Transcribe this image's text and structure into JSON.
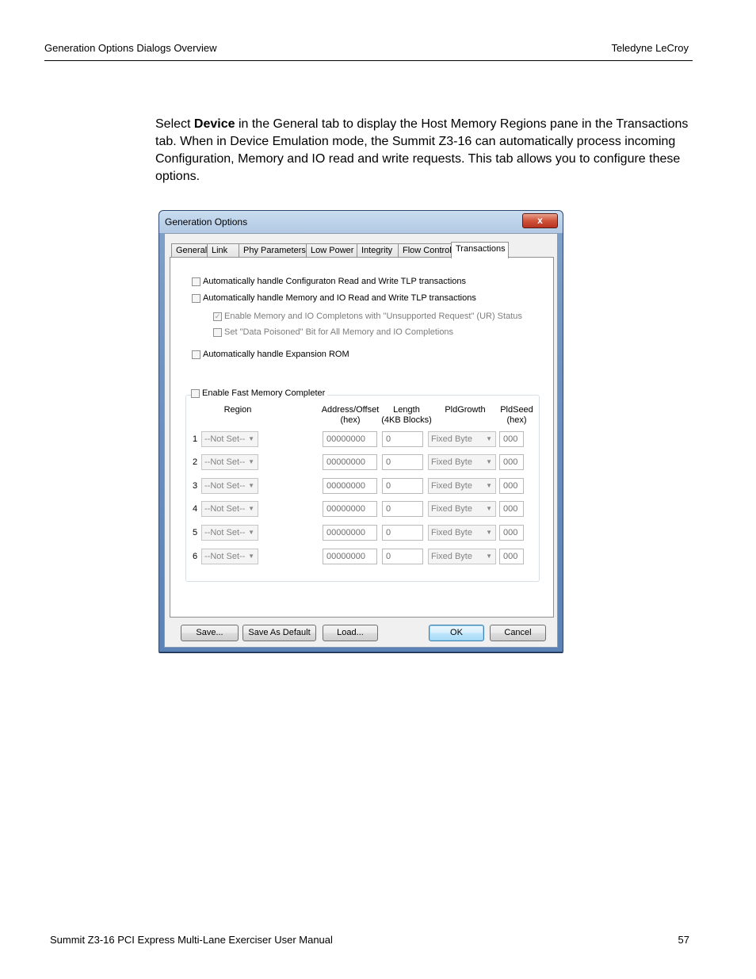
{
  "header": {
    "left": "Generation Options Dialogs Overview",
    "right": "Teledyne  LeCroy"
  },
  "intro": {
    "pre": "Select ",
    "bold": "Device",
    "post": " in the General tab to display the Host Memory Regions pane in the Transactions tab. When in Device Emulation mode, the Summit Z3-16 can automatically process incoming Configuration, Memory and IO read and write requests. This tab allows you to configure these options."
  },
  "dialog": {
    "title": "Generation Options",
    "close": "x",
    "tabs": [
      "General",
      "Link",
      "Phy Parameters",
      "Low Power",
      "Integrity",
      "Flow Control",
      "Transactions"
    ],
    "options": {
      "config": "Automatically handle Configuraton Read and Write TLP transactions",
      "memio": "Automatically handle Memory and IO Read and Write TLP transactions",
      "ur": "Enable Memory and IO Completons with \"Unsupported Request\" (UR) Status",
      "poisoned": "Set \"Data Poisoned\" Bit for All Memory and IO Completions",
      "rom": "Automatically handle Expansion ROM",
      "fast": "Enable Fast Memory Completer"
    },
    "columns": {
      "region": "Region",
      "address1": "Address/Offset",
      "address2": "(hex)",
      "length1": "Length",
      "length2": "(4KB Blocks)",
      "growth": "PldGrowth",
      "seed1": "PldSeed",
      "seed2": "(hex)"
    },
    "rows": [
      {
        "num": "1",
        "region": "--Not Set--",
        "address": "00000000",
        "length": "0",
        "growth": "Fixed Byte",
        "seed": "000"
      },
      {
        "num": "2",
        "region": "--Not Set--",
        "address": "00000000",
        "length": "0",
        "growth": "Fixed Byte",
        "seed": "000"
      },
      {
        "num": "3",
        "region": "--Not Set--",
        "address": "00000000",
        "length": "0",
        "growth": "Fixed Byte",
        "seed": "000"
      },
      {
        "num": "4",
        "region": "--Not Set--",
        "address": "00000000",
        "length": "0",
        "growth": "Fixed Byte",
        "seed": "000"
      },
      {
        "num": "5",
        "region": "--Not Set--",
        "address": "00000000",
        "length": "0",
        "growth": "Fixed Byte",
        "seed": "000"
      },
      {
        "num": "6",
        "region": "--Not Set--",
        "address": "00000000",
        "length": "0",
        "growth": "Fixed Byte",
        "seed": "000"
      }
    ],
    "buttons": {
      "save": "Save...",
      "save_default": "Save As Default",
      "load": "Load...",
      "ok": "OK",
      "cancel": "Cancel"
    }
  },
  "footer": {
    "left": "Summit Z3-16 PCI Express Multi-Lane Exerciser User Manual",
    "right": "57"
  }
}
